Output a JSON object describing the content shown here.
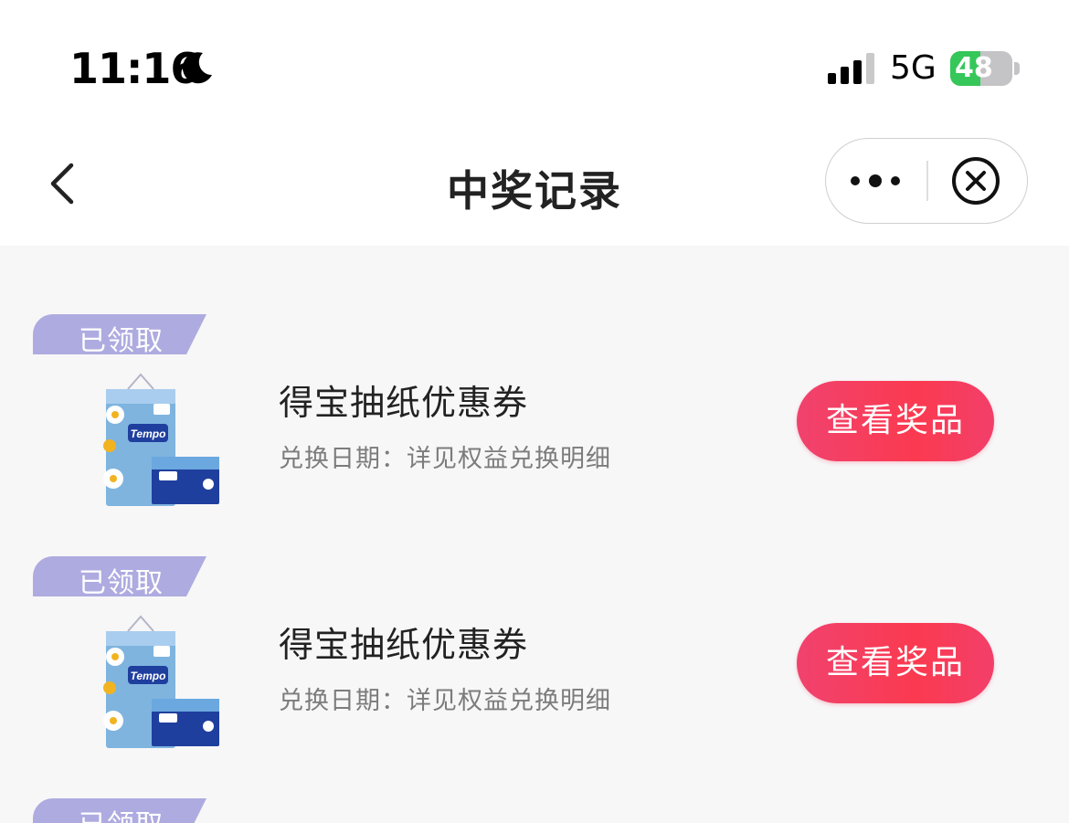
{
  "status_bar": {
    "time": "11:16",
    "network": "5G",
    "battery_level": "48",
    "battery_fraction": 0.48,
    "battery_color": "#35c759",
    "icons": [
      "moon-icon",
      "signal-icon",
      "battery-charging-icon"
    ]
  },
  "nav": {
    "title": "中奖记录",
    "back_icon": "chevron-left-icon",
    "more_icon": "more-dots-icon",
    "close_icon": "close-circle-icon"
  },
  "records": [
    {
      "status": "已领取",
      "name": "得宝抽纸优惠券",
      "date_text": "兑换日期：详见权益兑换明细",
      "button": "查看奖品",
      "image": "tempo-tissue-image"
    },
    {
      "status": "已领取",
      "name": "得宝抽纸优惠券",
      "date_text": "兑换日期：详见权益兑换明细",
      "button": "查看奖品",
      "image": "tempo-tissue-image"
    },
    {
      "status": "已领取"
    }
  ],
  "colors": {
    "tag": "#aeabe0",
    "button_start": "#f0426e",
    "button_end": "#fb3a50",
    "page_bg": "#f7f7f8"
  }
}
